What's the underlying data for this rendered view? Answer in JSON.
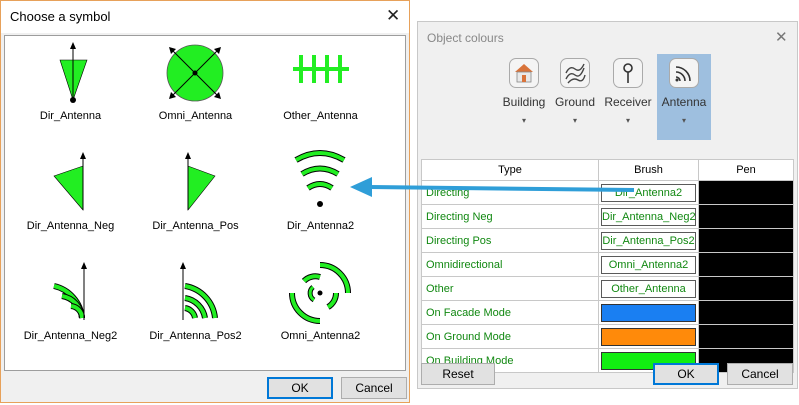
{
  "symbol_dialog": {
    "title": "Choose a symbol",
    "symbols": [
      {
        "label": "Dir_Antenna",
        "icon": "dir-antenna-icon"
      },
      {
        "label": "Omni_Antenna",
        "icon": "omni-antenna-icon"
      },
      {
        "label": "Other_Antenna",
        "icon": "other-antenna-icon"
      },
      {
        "label": "Dir_Antenna_Neg",
        "icon": "dir-antenna-neg-icon"
      },
      {
        "label": "Dir_Antenna_Pos",
        "icon": "dir-antenna-pos-icon"
      },
      {
        "label": "Dir_Antenna2",
        "icon": "dir-antenna2-icon"
      },
      {
        "label": "Dir_Antenna_Neg2",
        "icon": "dir-antenna-neg2-icon"
      },
      {
        "label": "Dir_Antenna_Pos2",
        "icon": "dir-antenna-pos2-icon"
      },
      {
        "label": "Omni_Antenna2",
        "icon": "omni-antenna2-icon"
      }
    ],
    "ok_label": "OK",
    "cancel_label": "Cancel"
  },
  "colours_dialog": {
    "title": "Object colours",
    "toolbar": [
      {
        "label": "Building",
        "icon": "building-icon"
      },
      {
        "label": "Ground",
        "icon": "ground-icon"
      },
      {
        "label": "Receiver",
        "icon": "receiver-icon"
      },
      {
        "label": "Antenna",
        "icon": "antenna-icon",
        "selected": true
      }
    ],
    "dropdown_glyph": "▾",
    "table": {
      "headers": {
        "type": "Type",
        "brush": "Brush",
        "pen": "Pen"
      },
      "rows": [
        {
          "type": "Directing",
          "brush": "Dir_Antenna2",
          "pen_color": "#000000"
        },
        {
          "type": "Directing Neg",
          "brush": "Dir_Antenna_Neg2",
          "pen_color": "#000000"
        },
        {
          "type": "Directing Pos",
          "brush": "Dir_Antenna_Pos2",
          "pen_color": "#000000"
        },
        {
          "type": "Omnidirectional",
          "brush": "Omni_Antenna2",
          "pen_color": "#000000"
        },
        {
          "type": "Other",
          "brush": "Other_Antenna",
          "pen_color": "#000000"
        },
        {
          "type": "On Facade Mode",
          "brush": "",
          "brush_color": "#1a7ff2",
          "pen_color": "#000000"
        },
        {
          "type": "On Ground Mode",
          "brush": "",
          "brush_color": "#ff8a0a",
          "pen_color": "#000000"
        },
        {
          "type": "On Building Mode",
          "brush": "",
          "brush_color": "#11ee11",
          "pen_color": "#000000"
        }
      ]
    },
    "reset_label": "Reset",
    "ok_label": "OK",
    "cancel_label": "Cancel"
  },
  "colors": {
    "symbol_green": "#22ee22",
    "type_text": "#118811",
    "arrow": "#2f9ed8",
    "toolbar_selected": "#9ebfdf"
  }
}
